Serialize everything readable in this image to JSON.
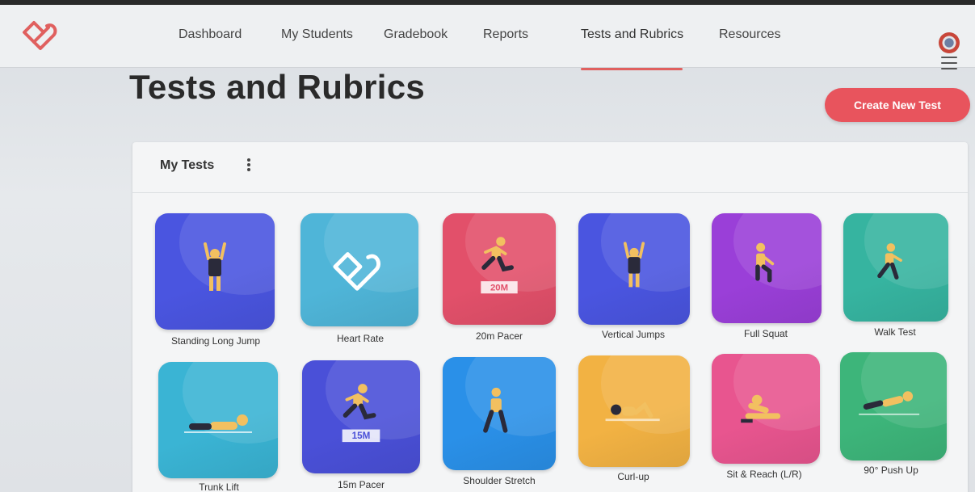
{
  "app": {
    "nav": {
      "items": [
        {
          "label": "Dashboard"
        },
        {
          "label": "My Students"
        },
        {
          "label": "Gradebook"
        },
        {
          "label": "Reports"
        },
        {
          "label": "Tests and Rubrics",
          "active": true
        },
        {
          "label": "Resources"
        }
      ]
    }
  },
  "page": {
    "title": "Tests and Rubrics",
    "create_button": "Create New Test"
  },
  "my_tests": {
    "title": "My Tests",
    "tiles": [
      {
        "label": "Standing Long Jump",
        "color": "#4a55e0",
        "icon": "standing-figure-icon"
      },
      {
        "label": "Heart Rate",
        "color": "#4fb5d8",
        "icon": "heart-logo-icon"
      },
      {
        "label": "20m Pacer",
        "color": "#e2506a",
        "icon": "runner-icon",
        "badge": "20M"
      },
      {
        "label": "Vertical Jumps",
        "color": "#4a55e0",
        "icon": "standing-figure-icon"
      },
      {
        "label": "Full Squat",
        "color": "#9a3fd8",
        "icon": "squat-icon"
      },
      {
        "label": "Walk Test",
        "color": "#36b4a0",
        "icon": "walker-icon"
      },
      {
        "label": "Trunk Lift",
        "color": "#3ab4d4",
        "icon": "prone-figure-icon"
      },
      {
        "label": "15m Pacer",
        "color": "#4a50d8",
        "icon": "runner-icon",
        "badge": "15M"
      },
      {
        "label": "Shoulder Stretch",
        "color": "#2a90e8",
        "icon": "stretch-figure-icon"
      },
      {
        "label": "Curl-up",
        "color": "#f2b243",
        "icon": "curlup-icon"
      },
      {
        "label": "Sit & Reach (L/R)",
        "color": "#e8558f",
        "icon": "sit-reach-icon"
      },
      {
        "label": "90° Push Up",
        "color": "#3db57a",
        "icon": "pushup-icon"
      }
    ]
  },
  "colors": {
    "accent": "#e8545d",
    "nav_underline": "#e0605f"
  }
}
